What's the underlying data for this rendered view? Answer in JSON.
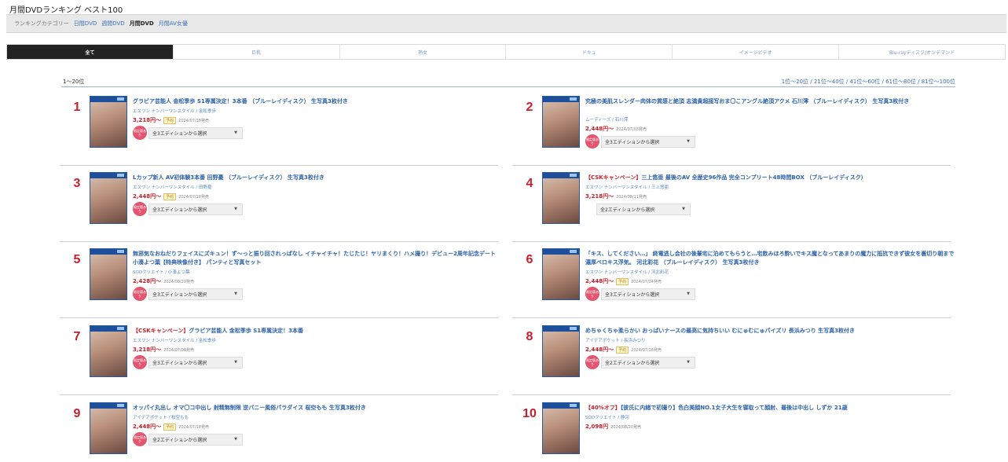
{
  "page_title": "月間DVDランキング ベスト100",
  "category_bar": {
    "label": "ランキングカテゴリー",
    "links": [
      "日間DVD",
      "週間DVD"
    ],
    "current": "月間DVD",
    "last": "月間AV女優"
  },
  "tabs": [
    "全て",
    "巨乳",
    "熟女",
    "ドキュ",
    "イメージビデオ",
    "Blu-rayディスク/オンデマンド"
  ],
  "range": {
    "current": "1〜20位",
    "pages": "1位〜20位 / 21位〜40位 / 41位〜60位 / 61位〜80位 / 81位〜100位"
  },
  "common": {
    "limited_badge": "限定版あり",
    "preorder": "予約",
    "select_caret": "▼"
  },
  "items": [
    {
      "rank": "1",
      "camp": "",
      "title": "グラビア芸能人 金松季歩 S1専属決定！3本番 （ブルーレイディスク） 生写真3枚付き",
      "meta": "エスワン ナンバーワンスタイル / 金松季歩",
      "price": "3,218円〜",
      "preorder": true,
      "date": "2024/07/18発売",
      "edition": "全3エディションから選択",
      "limited": true
    },
    {
      "rank": "2",
      "camp": "",
      "title": "究極の美肌スレンダー肉体の質感と絶頂 志満貴超接写おま〇こアングル絶頂アクメ 石川澪 （ブルーレイディスク） 生写真3枚付き",
      "meta": "ムーディーズ / 石川澪",
      "price": "2,448円〜",
      "preorder": false,
      "date": "2024/07/03発売",
      "edition": "全3エディションから選択",
      "limited": true
    },
    {
      "rank": "3",
      "camp": "",
      "title": "Lカップ新人 AV初体験3本番 田野憂 （ブルーレイディスク） 生写真3枚付き",
      "meta": "エスワン ナンバーワンスタイル / 田野憂",
      "price": "2,448円〜",
      "preorder": true,
      "date": "2024/07/18発売",
      "edition": "全3エディションから選択",
      "limited": true
    },
    {
      "rank": "4",
      "camp": "【CSKキャンペーン】",
      "title": "三上悠亜 最後のAV 全歴史96作品 完全コンプリート48時間BOX （ブルーレイディスク）",
      "meta": "エスワン ナンバーワンスタイル / 三上悠亜",
      "price": "3,218円〜",
      "preorder": false,
      "date": "2024/08/11発売",
      "edition": "全2エディションから選択",
      "limited": false
    },
    {
      "rank": "5",
      "camp": "",
      "title": "無邪気なおねだりフェイスにズキュン！ず〜っと振り回されっぱなし イチャイチャ！たじたじ！ヤリまくり！ハメ撮り！デビュー2周年記念デート 小湊よつ葉【特典映像付き】 パンティと写真セット",
      "meta": "SODクリエイト / 小湊よつ葉",
      "price": "2,428円〜",
      "preorder": false,
      "date": "2024/08/20発売",
      "edition": "全3エディションから選択",
      "limited": true
    },
    {
      "rank": "6",
      "camp": "",
      "title": "「キス、してください…」 終電逃し会社の後輩宅に泊めてもらうと…宅飲みほろ酔いでキス魔となってあまりの魔力に抵抗できず彼女を裏切り朝まで濃厚ベロキス浮気。 河北彩花 （ブルーレイディスク） 生写真3枚付き",
      "meta": "エスワン ナンバーワンスタイル / 河北彩花",
      "price": "2,448円〜",
      "preorder": true,
      "date": "2024/07/24発売",
      "edition": "全3エディションから選択",
      "limited": true
    },
    {
      "rank": "7",
      "camp": "【CSKキャンペーン】",
      "title": "グラビア芸能人 金松季歩 S1専属決定！3本番",
      "meta": "エスワン ナンバーワンスタイル / 金松季歩",
      "price": "3,218円〜",
      "preorder": false,
      "date": "2024/07/08発売",
      "edition": "全3エディションから選択",
      "limited": true
    },
    {
      "rank": "8",
      "camp": "",
      "title": "めちゃくちゃ柔らかい おっぱいナースの最高に気持ちいい むにゅむにゅパイズリ 長浜みつり 生写真3枚付き",
      "meta": "アイデアポケット / 長浜みつり",
      "price": "2,448円〜",
      "preorder": true,
      "date": "2024/07/18発売",
      "edition": "全2エディションから選択",
      "limited": true
    },
    {
      "rank": "9",
      "camp": "",
      "title": "オッパイ丸出し オマ〇コ中出し 射精無制限 逆バニー風俗パラダイス 桜空もも 生写真3枚付き",
      "meta": "アイデアポケット / 桜空もも",
      "price": "2,448円〜",
      "preorder": true,
      "date": "2024/07/18発売",
      "edition": "全2エディションから選択",
      "limited": true
    },
    {
      "rank": "10",
      "camp": "【40%オフ】",
      "title": "【彼氏に内緒で初撮り】色白美顔NO.1女子大生を寝取って顔射、最後は中出し しずか 21歳",
      "meta": "SODクリエイト / 静河",
      "price": "2,098円",
      "preorder": false,
      "date": "2024/08/20発売",
      "edition": "",
      "limited": false
    }
  ]
}
